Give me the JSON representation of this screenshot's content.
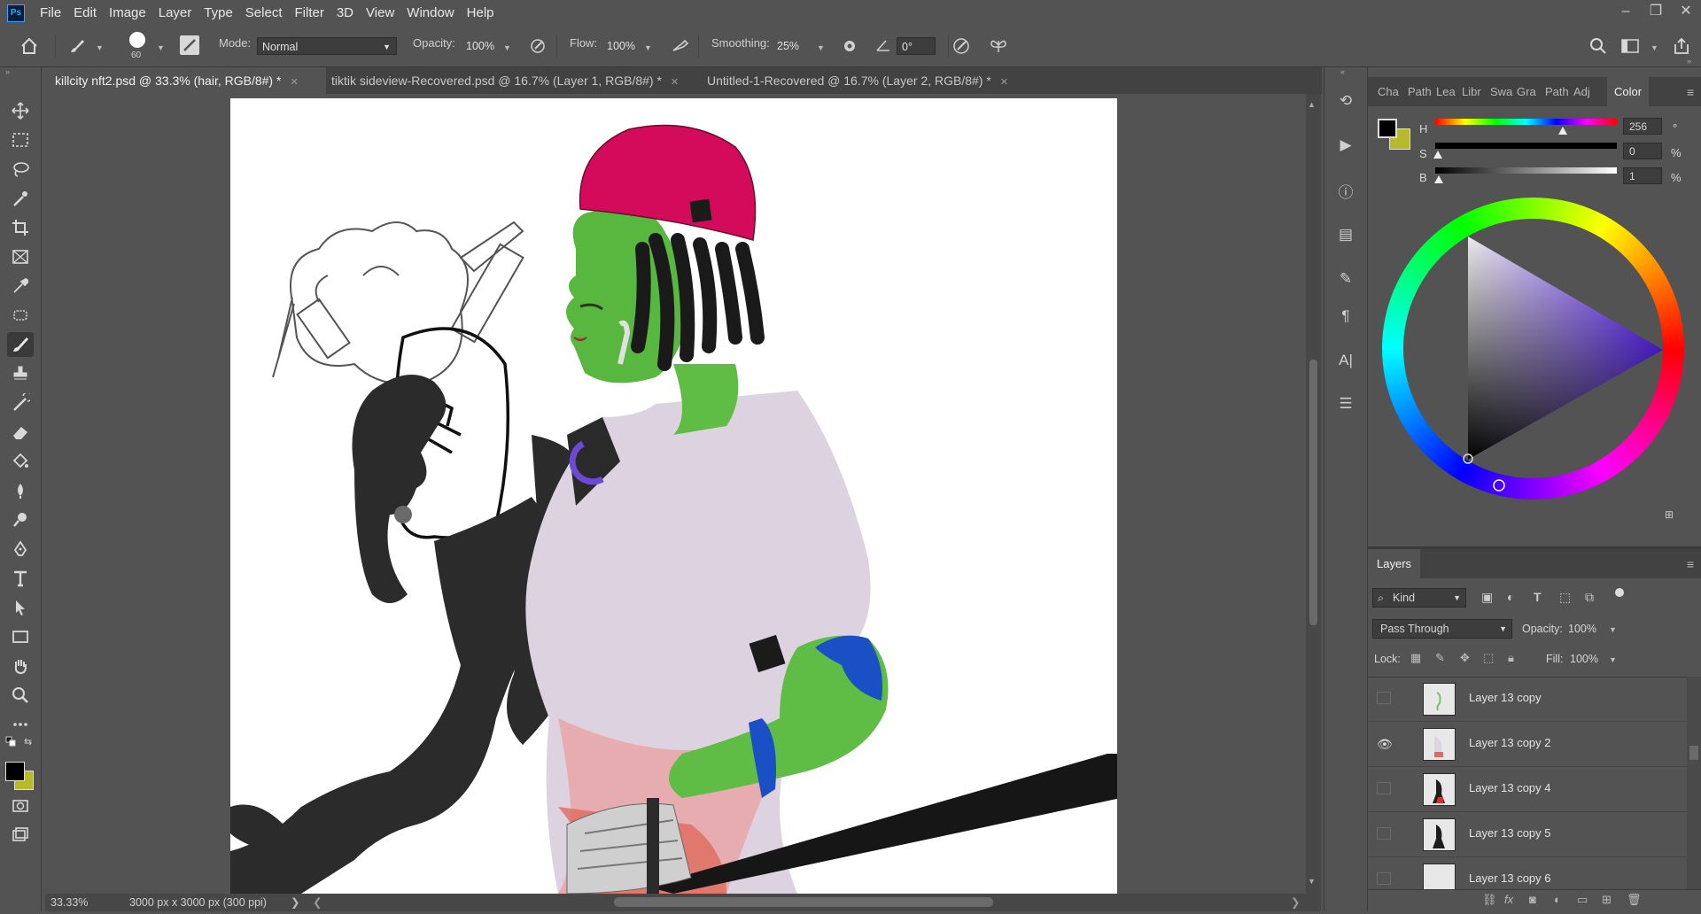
{
  "menubar": {
    "logo": "Ps",
    "items": [
      "File",
      "Edit",
      "Image",
      "Layer",
      "Type",
      "Select",
      "Filter",
      "3D",
      "View",
      "Window",
      "Help"
    ],
    "window_controls": [
      "–",
      "❐",
      "✕"
    ]
  },
  "options": {
    "brush_size": "60",
    "mode_label": "Mode:",
    "mode_value": "Normal",
    "opacity_label": "Opacity:",
    "opacity_value": "100%",
    "flow_label": "Flow:",
    "flow_value": "100%",
    "smoothing_label": "Smoothing:",
    "smoothing_value": "25%",
    "angle_value": "0°"
  },
  "tabs": [
    {
      "label": "killcity nft2.psd @ 33.3% (hair, RGB/8#) *",
      "active": true
    },
    {
      "label": "tiktik sideview-Recovered.psd @ 16.7% (Layer 1, RGB/8#) *",
      "active": false
    },
    {
      "label": "Untitled-1-Recovered @ 16.7% (Layer 2, RGB/8#) *",
      "active": false
    }
  ],
  "status": {
    "zoom": "33.33%",
    "doc_info": "3000 px x 3000 px (300 ppi)"
  },
  "color_panel": {
    "tabs": [
      "Cha",
      "Path",
      "Lea",
      "Libr",
      "Swa",
      "Gra",
      "Path",
      "Adj",
      "Color"
    ],
    "active_tab": "Color",
    "h_label": "H",
    "h_value": "256",
    "h_unit": "°",
    "s_label": "S",
    "s_value": "0",
    "s_unit": "%",
    "b_label": "B",
    "b_value": "1",
    "b_unit": "%",
    "foreground": "#000000",
    "background": "#b5b92a"
  },
  "layers_panel": {
    "title": "Layers",
    "filter_kind": "Kind",
    "blend_mode": "Pass Through",
    "opacity_label": "Opacity:",
    "opacity_value": "100%",
    "lock_label": "Lock:",
    "fill_label": "Fill:",
    "fill_value": "100%",
    "layers": [
      {
        "name": "Layer 13 copy",
        "visible": false
      },
      {
        "name": "Layer 13 copy 2",
        "visible": true
      },
      {
        "name": "Layer 13 copy 4",
        "visible": false
      },
      {
        "name": "Layer 13 copy 5",
        "visible": false
      },
      {
        "name": "Layer 13 copy 6",
        "visible": false
      }
    ]
  }
}
